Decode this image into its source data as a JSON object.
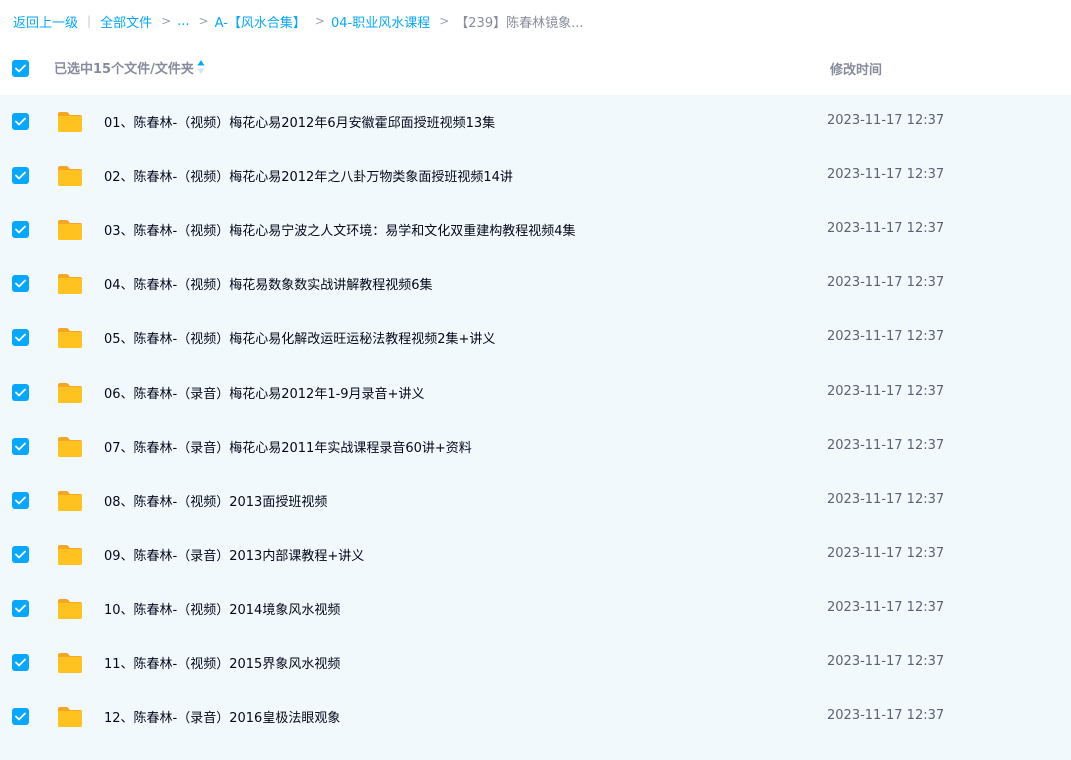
{
  "breadcrumb": {
    "back": "返回上一级",
    "all_files": "全部文件",
    "ellipsis": "...",
    "crumb_1": "A-【风水合集】",
    "crumb_2": "04-职业风水课程",
    "current": "【239】陈春林镜象...",
    "separator": "|",
    "chevron": ">"
  },
  "header": {
    "selected_text": "已选中15个文件/文件夹",
    "modified_time_label": "修改时间",
    "sort_icon": "sort-icon"
  },
  "colors": {
    "accent": "#06a7ff",
    "row_selected_bg": "#f2f9fd",
    "folder": "#ffc21f"
  },
  "files": [
    {
      "name": "01、陈春林-（视频）梅花心易2012年6月安徽霍邱面授班视频13集",
      "time": "2023-11-17 12:37",
      "type": "folder-icon",
      "checked": true
    },
    {
      "name": "02、陈春林-（视频）梅花心易2012年之八卦万物类象面授班视频14讲",
      "time": "2023-11-17 12:37",
      "type": "folder-icon",
      "checked": true
    },
    {
      "name": "03、陈春林-（视频）梅花心易宁波之人文环境：易学和文化双重建构教程视频4集",
      "time": "2023-11-17 12:37",
      "type": "folder-icon",
      "checked": true
    },
    {
      "name": "04、陈春林-（视频）梅花易数象数实战讲解教程视频6集",
      "time": "2023-11-17 12:37",
      "type": "folder-icon",
      "checked": true
    },
    {
      "name": "05、陈春林-（视频）梅花心易化解改运旺运秘法教程视频2集+讲义",
      "time": "2023-11-17 12:37",
      "type": "folder-icon",
      "checked": true
    },
    {
      "name": "06、陈春林-（录音）梅花心易2012年1-9月录音+讲义",
      "time": "2023-11-17 12:37",
      "type": "folder-icon",
      "checked": true
    },
    {
      "name": "07、陈春林-（录音）梅花心易2011年实战课程录音60讲+资料",
      "time": "2023-11-17 12:37",
      "type": "folder-icon",
      "checked": true
    },
    {
      "name": "08、陈春林-（视频）2013面授班视频",
      "time": "2023-11-17 12:37",
      "type": "folder-icon",
      "checked": true
    },
    {
      "name": "09、陈春林-（录音）2013内部课教程+讲义",
      "time": "2023-11-17 12:37",
      "type": "folder-icon",
      "checked": true
    },
    {
      "name": "10、陈春林-（视频）2014境象风水视频",
      "time": "2023-11-17 12:37",
      "type": "folder-icon",
      "checked": true
    },
    {
      "name": "11、陈春林-（视频）2015界象风水视频",
      "time": "2023-11-17 12:37",
      "type": "folder-icon",
      "checked": true
    },
    {
      "name": "12、陈春林-（录音）2016皇极法眼观象",
      "time": "2023-11-17 12:37",
      "type": "folder-icon",
      "checked": true
    }
  ]
}
